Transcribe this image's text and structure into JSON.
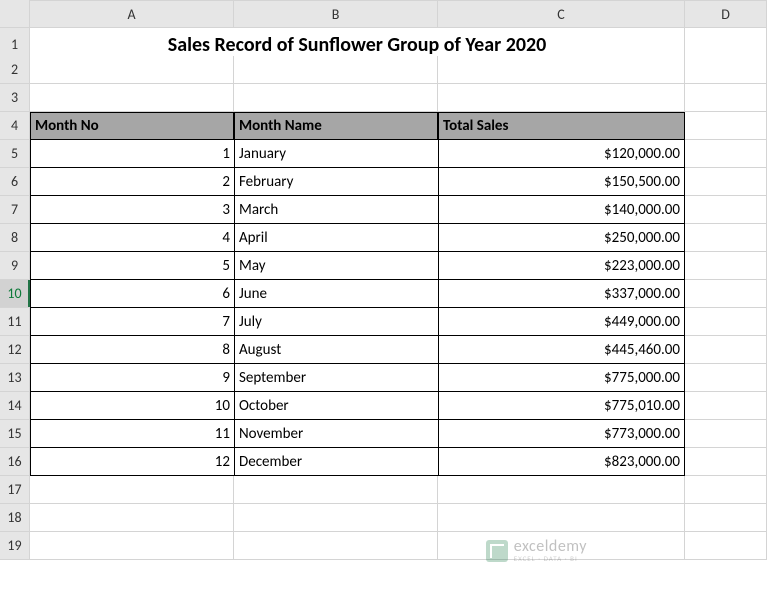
{
  "columns": [
    "A",
    "B",
    "C",
    "D"
  ],
  "row_numbers": [
    "1",
    "2",
    "3",
    "4",
    "5",
    "6",
    "7",
    "8",
    "9",
    "10",
    "11",
    "12",
    "13",
    "14",
    "15",
    "16",
    "17",
    "18",
    "19"
  ],
  "selected_row_index": 9,
  "title": "Sales Record of Sunflower Group of Year 2020",
  "headers": {
    "col_a": "Month No",
    "col_b": "Month Name",
    "col_c": "Total Sales"
  },
  "rows": [
    {
      "no": "1",
      "month": "January",
      "sales": "$120,000.00"
    },
    {
      "no": "2",
      "month": "February",
      "sales": "$150,500.00"
    },
    {
      "no": "3",
      "month": "March",
      "sales": "$140,000.00"
    },
    {
      "no": "4",
      "month": "April",
      "sales": "$250,000.00"
    },
    {
      "no": "5",
      "month": "May",
      "sales": "$223,000.00"
    },
    {
      "no": "6",
      "month": "June",
      "sales": "$337,000.00"
    },
    {
      "no": "7",
      "month": "July",
      "sales": "$449,000.00"
    },
    {
      "no": "8",
      "month": "August",
      "sales": "$445,460.00"
    },
    {
      "no": "9",
      "month": "September",
      "sales": "$775,000.00"
    },
    {
      "no": "10",
      "month": "October",
      "sales": "$775,010.00"
    },
    {
      "no": "11",
      "month": "November",
      "sales": "$773,000.00"
    },
    {
      "no": "12",
      "month": "December",
      "sales": "$823,000.00"
    }
  ],
  "watermark": {
    "name": "exceldemy",
    "sub": "EXCEL · DATA · BI"
  }
}
